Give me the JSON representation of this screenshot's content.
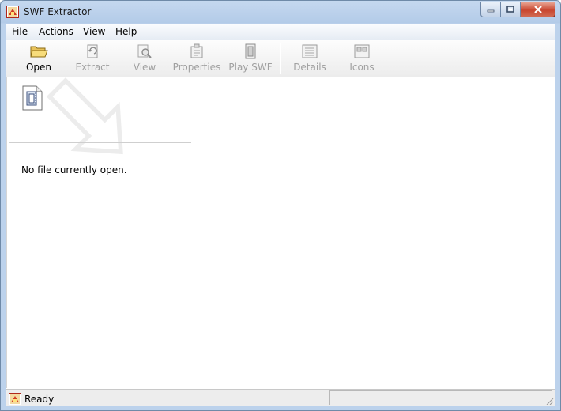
{
  "window": {
    "title": "SWF Extractor"
  },
  "menu": [
    "File",
    "Actions",
    "View",
    "Help"
  ],
  "toolbar": [
    {
      "label": "Open",
      "icon": "folder-open-icon",
      "enabled": true
    },
    {
      "label": "Extract",
      "icon": "extract-icon",
      "enabled": false
    },
    {
      "label": "View",
      "icon": "view-magnifier-icon",
      "enabled": false
    },
    {
      "label": "Properties",
      "icon": "properties-icon",
      "enabled": false
    },
    {
      "label": "Play SWF",
      "icon": "film-icon",
      "enabled": false
    },
    {
      "label": "Details",
      "icon": "details-view-icon",
      "enabled": false
    },
    {
      "label": "Icons",
      "icon": "icons-view-icon",
      "enabled": false
    }
  ],
  "content": {
    "message": "No file currently open."
  },
  "status": {
    "text": "Ready"
  },
  "colors": {
    "close_button": "#c8462f",
    "title_bar": "#b3cbe8",
    "disabled_text": "#a0a0a0"
  }
}
